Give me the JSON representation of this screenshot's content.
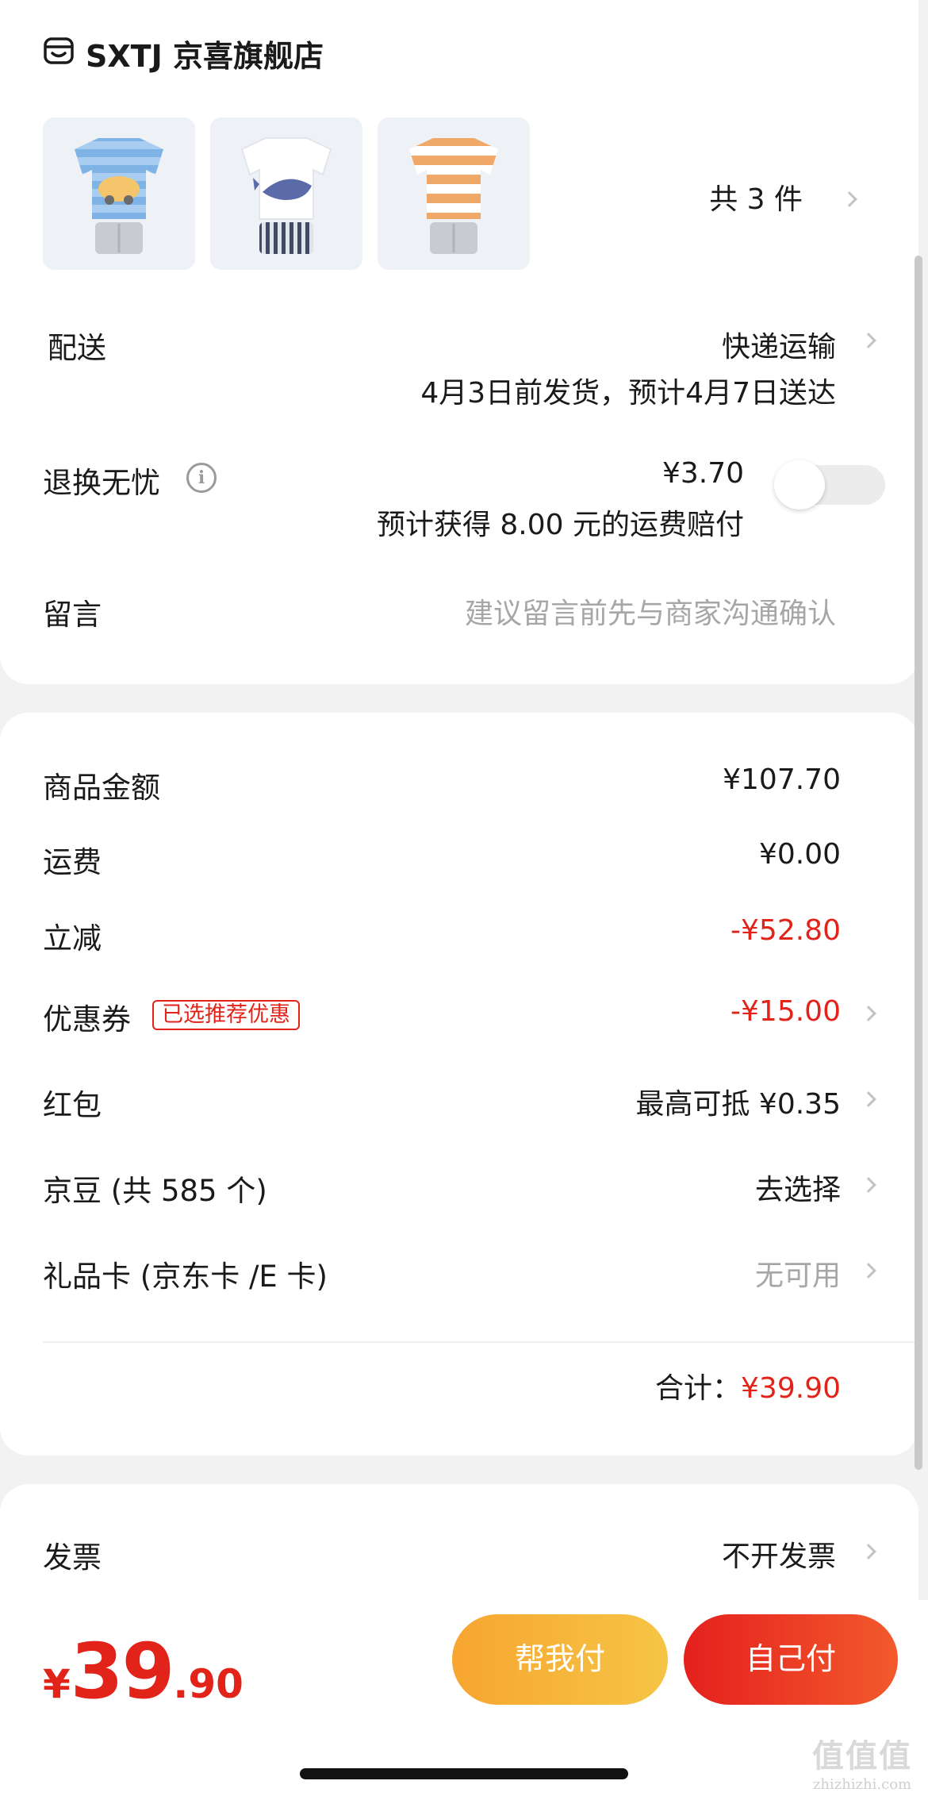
{
  "store": {
    "name": "SXTJ 京喜旗舰店",
    "icon": "store-icon",
    "item_count_text": "共 3 件"
  },
  "products": [
    {
      "name": "blue-striped-car-tshirt-set",
      "color": "#7fb2e5"
    },
    {
      "name": "white-whale-tshirt-set",
      "color": "#ffffff"
    },
    {
      "name": "orange-striped-tshirt-set",
      "color": "#f0a868"
    }
  ],
  "delivery": {
    "label": "配送",
    "method": "快递运输",
    "eta": "4月3日前发货，预计4月7日送达"
  },
  "return_insurance": {
    "label": "退换无忧",
    "price": "¥3.70",
    "desc": "预计获得 8.00 元的运费赔付",
    "enabled": false
  },
  "message": {
    "label": "留言",
    "placeholder": "建议留言前先与商家沟通确认"
  },
  "fees": {
    "goods_label": "商品金额",
    "goods_value": "¥107.70",
    "shipping_label": "运费",
    "shipping_value": "¥0.00",
    "discount_label": "立减",
    "discount_value": "-¥52.80",
    "coupon_label": "优惠券",
    "coupon_tag": "已选推荐优惠",
    "coupon_value": "-¥15.00",
    "redpacket_label": "红包",
    "redpacket_value": "最高可抵 ¥0.35",
    "jingdou_label": "京豆 (共 585 个)",
    "jingdou_value": "去选择",
    "giftcard_label": "礼品卡 (京东卡 /E 卡)",
    "giftcard_value": "无可用",
    "total_label": "合计：",
    "total_value": "¥39.90"
  },
  "invoice": {
    "label": "发票",
    "value": "不开发票"
  },
  "bottom": {
    "currency": "¥",
    "price_int": "39",
    "price_dec": ".90",
    "help_pay": "帮我付",
    "self_pay": "自己付"
  },
  "watermark": {
    "logo": "值值值",
    "domain": "zhizhizhi.com"
  },
  "colors": {
    "accent_red": "#e2231a",
    "help_btn": "#f7b733",
    "self_btn": "#ee3a23"
  }
}
